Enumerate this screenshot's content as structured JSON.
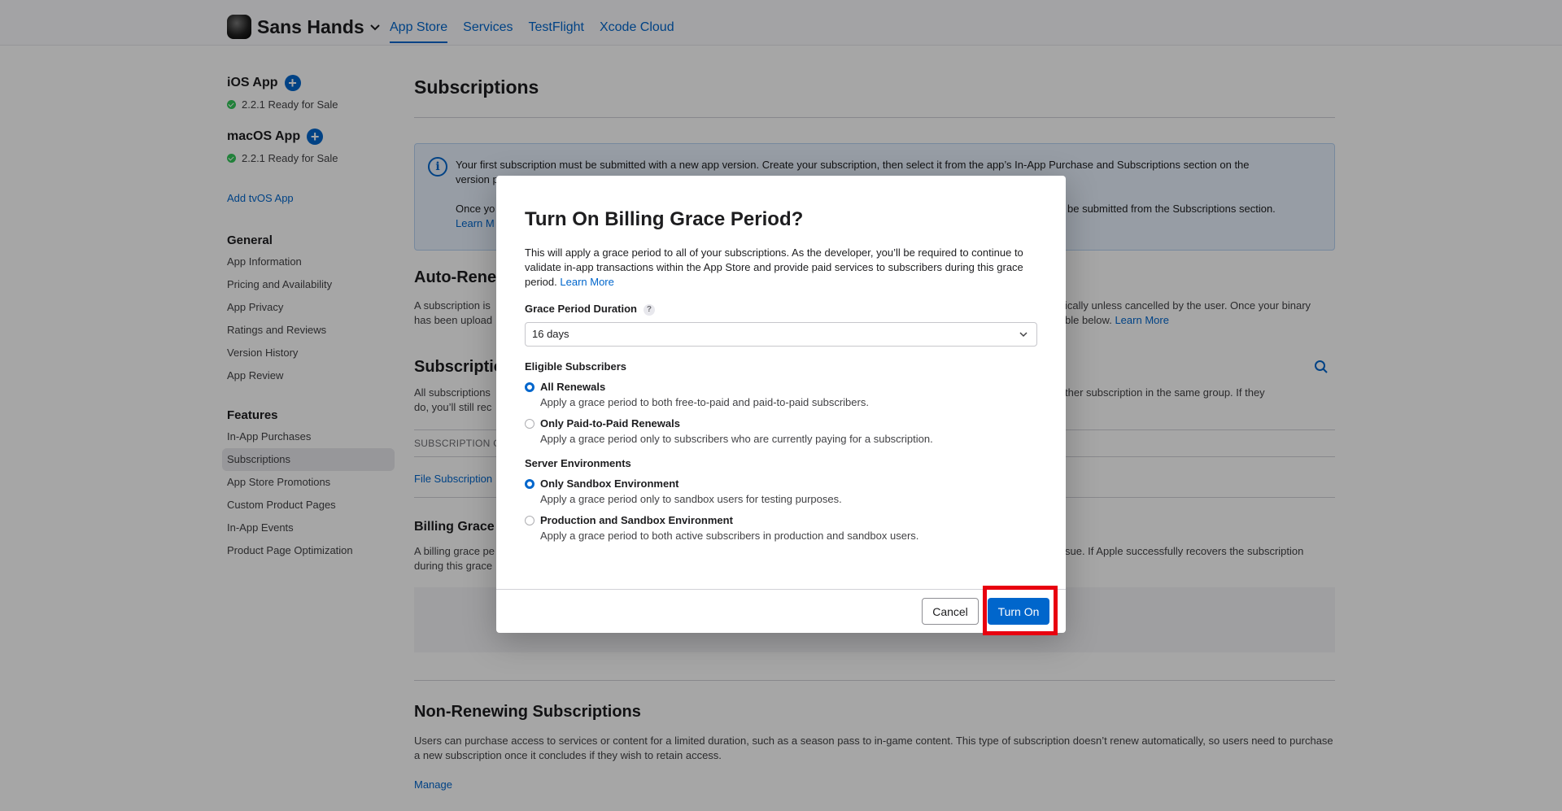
{
  "topbar": {
    "account_name": "Sans Hands",
    "nav": [
      "App Store",
      "Services",
      "TestFlight",
      "Xcode Cloud"
    ],
    "active_nav": "App Store"
  },
  "sidebar": {
    "platforms": [
      {
        "title": "iOS App",
        "status": "2.2.1 Ready for Sale"
      },
      {
        "title": "macOS App",
        "status": "2.2.1 Ready for Sale"
      }
    ],
    "add_link": "Add tvOS App",
    "general": {
      "title": "General",
      "items": [
        "App Information",
        "Pricing and Availability",
        "App Privacy",
        "Ratings and Reviews",
        "Version History",
        "App Review"
      ]
    },
    "features": {
      "title": "Features",
      "items": [
        "In-App Purchases",
        "Subscriptions",
        "App Store Promotions",
        "Custom Product Pages",
        "In-App Events",
        "Product Page Optimization"
      ],
      "selected": "Subscriptions"
    }
  },
  "main": {
    "title": "Subscriptions",
    "info": {
      "line1a": "Your first subscription must be submitted with a new app version. Create your subscription, then select it from the app’s In-App Purchase and Subscriptions section on the",
      "line1b": "version p",
      "line2a": "Once yo",
      "line2b": "be submitted from the Subscriptions section.",
      "learn": "Learn M"
    },
    "auto_renew": {
      "title": "Auto-Rene",
      "text_left_1": "A subscription is",
      "text_left_2": "has been upload",
      "text_right_1": "ically unless cancelled by the user. Once your binary",
      "text_right_2": "ble below.",
      "learn_more": "Learn More"
    },
    "groups": {
      "title": "Subscriptio",
      "text_left_1": "All subscriptions",
      "text_left_2": "do, you’ll still rec",
      "text_right_1": "ther subscription in the same group. If they",
      "table_header": "SUBSCRIPTION G",
      "file_link": "File Subscription"
    },
    "billing": {
      "title": "Billing Grace P",
      "text_left_1": "A billing grace pe",
      "text_left_2": "during this grace",
      "text_right_1": "sue. If Apple successfully recovers the subscription"
    },
    "non_renewing": {
      "title": "Non-Renewing Subscriptions",
      "text": "Users can purchase access to services or content for a limited duration, such as a season pass to in-game content. This type of subscription doesn’t renew automatically, so users need to purchase a new subscription once it concludes if they wish to retain access.",
      "manage": "Manage"
    }
  },
  "modal": {
    "title": "Turn On Billing Grace Period?",
    "description": "This will apply a grace period to all of your subscriptions. As the developer, you’ll be required to continue to validate in-app transactions within the App Store and provide paid services to subscribers during this grace period.",
    "learn_more": "Learn More",
    "duration_label": "Grace Period Duration",
    "help": "?",
    "duration_value": "16 days",
    "eligible_label": "Eligible Subscribers",
    "eligible_options": [
      {
        "label": "All Renewals",
        "sub": "Apply a grace period to both free-to-paid and paid-to-paid subscribers.",
        "selected": true
      },
      {
        "label": "Only Paid-to-Paid Renewals",
        "sub": "Apply a grace period only to subscribers who are currently paying for a subscription.",
        "selected": false
      }
    ],
    "env_label": "Server Environments",
    "env_options": [
      {
        "label": "Only Sandbox Environment",
        "sub": "Apply a grace period only to sandbox users for testing purposes.",
        "selected": true
      },
      {
        "label": "Production and Sandbox Environment",
        "sub": "Apply a grace period to both active subscribers in production and sandbox users.",
        "selected": false
      }
    ],
    "cancel": "Cancel",
    "confirm": "Turn On"
  },
  "colors": {
    "accent": "#0066cc",
    "highlight": "#e8000f",
    "status_ok": "#34c759"
  }
}
